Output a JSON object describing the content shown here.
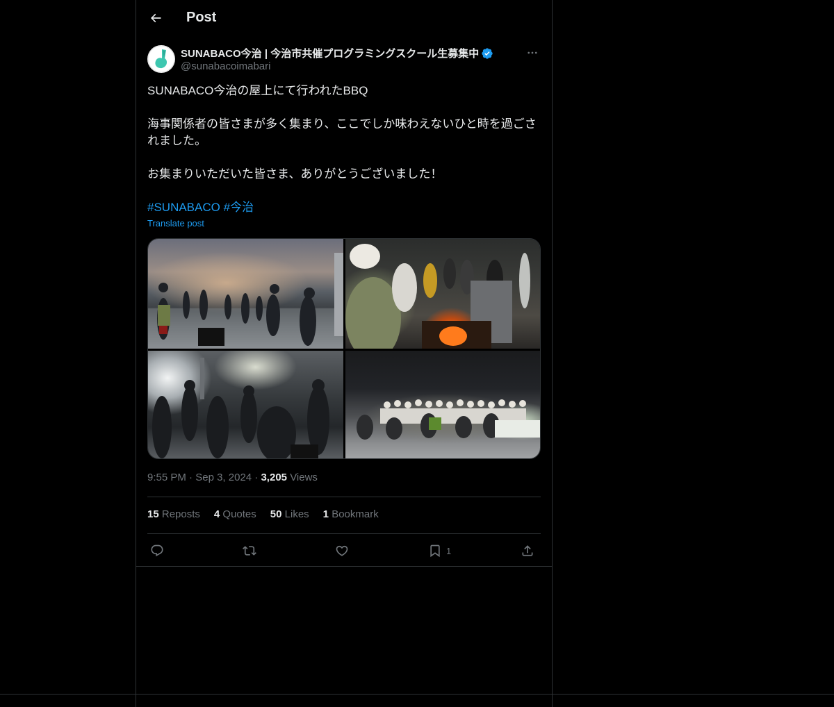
{
  "header": {
    "title": "Post"
  },
  "author": {
    "display_name": "SUNABACO今治 | 今治市共催プログラミングスクール生募集中",
    "handle": "@sunabacoimabari",
    "verified_color": "#1d9bf0"
  },
  "post": {
    "line1": "SUNABACO今治の屋上にて行われたBBQ",
    "line2": "海事関係者の皆さまが多く集まり、ここでしか味わえないひと時を過ごされました。",
    "line3": "お集まりいただいた皆さま、ありがとうございました！",
    "hashtags": [
      "#SUNABACO",
      "#今治"
    ],
    "translate_label": "Translate post"
  },
  "meta": {
    "time": "9:55 PM",
    "date": "Sep 3, 2024",
    "views_count": "3,205",
    "views_label": "Views"
  },
  "stats": [
    {
      "count": "15",
      "label": "Reposts"
    },
    {
      "count": "4",
      "label": "Quotes"
    },
    {
      "count": "50",
      "label": "Likes"
    },
    {
      "count": "1",
      "label": "Bookmark"
    }
  ],
  "actions": {
    "bookmark_count": "1"
  },
  "icons": {
    "back": "arrow-left-icon",
    "more": "more-horizontal-icon",
    "reply": "reply-icon",
    "repost": "repost-icon",
    "like": "heart-icon",
    "bookmark": "bookmark-icon",
    "share": "share-icon"
  },
  "colors": {
    "background": "#000000",
    "text": "#e7e9ea",
    "secondary_text": "#71767b",
    "accent": "#1d9bf0",
    "border": "#2f3336"
  }
}
